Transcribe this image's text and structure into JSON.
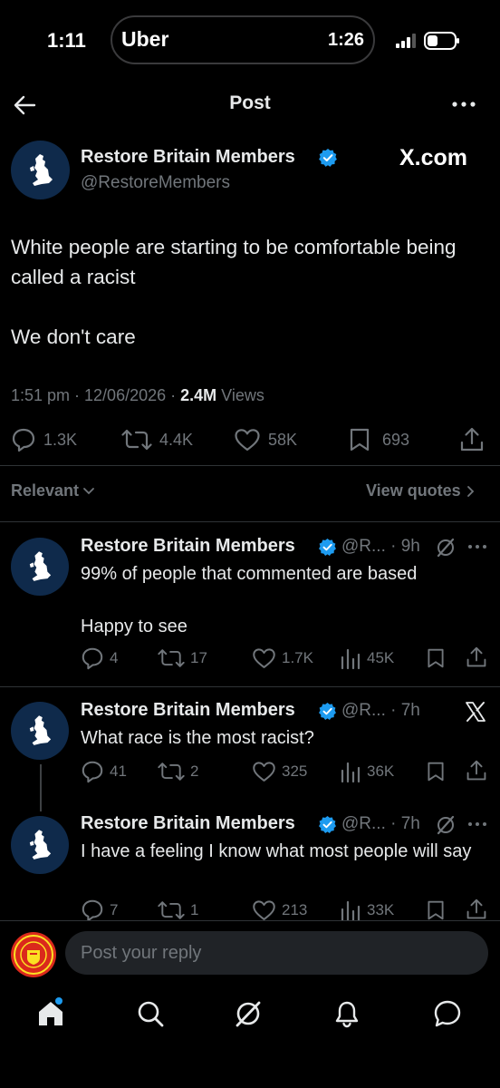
{
  "status_bar": {
    "time": "1:11",
    "live_activity_app": "Uber",
    "live_activity_time": "1:26"
  },
  "header": {
    "title": "Post"
  },
  "post": {
    "author_name": "Restore Britain Members",
    "handle": "@RestoreMembers",
    "watermark": "X.com",
    "text_line1": "White people are starting to be comfortable being called a racist",
    "text_line2": "We don't care",
    "time_date": "1:51 pm · 12/06/2026 · ",
    "views_count": "2.4M",
    "views_label": " Views",
    "actions": {
      "replies": "1.3K",
      "reposts": "4.4K",
      "likes": "58K",
      "bookmarks": "693"
    }
  },
  "filters": {
    "sort_label": "Relevant",
    "view_quotes_label": "View quotes"
  },
  "replies": [
    {
      "author_name": "Restore Britain Members",
      "handle_time": "@R... · 9h",
      "text_line1": "99% of people that commented are based",
      "text_line2": "Happy to see",
      "replies": "4",
      "reposts": "17",
      "likes": "1.7K",
      "views": "45K"
    },
    {
      "author_name": "Restore Britain Members",
      "handle_time": "@R... · 7h",
      "text_line1": "What race is the most racist?",
      "replies": "41",
      "reposts": "2",
      "likes": "325",
      "views": "36K"
    },
    {
      "author_name": "Restore Britain Members",
      "handle_time": "@R... · 7h",
      "text_line1": "I have a feeling I know what most people will say",
      "replies": "7",
      "reposts": "1",
      "likes": "213",
      "views": "33K"
    }
  ],
  "reply_bar": {
    "placeholder": "Post your reply"
  },
  "colors": {
    "background": "#000000",
    "accent": "#1d9bf0",
    "muted": "#71767b",
    "avatar_bg": "#0f2a4b"
  }
}
